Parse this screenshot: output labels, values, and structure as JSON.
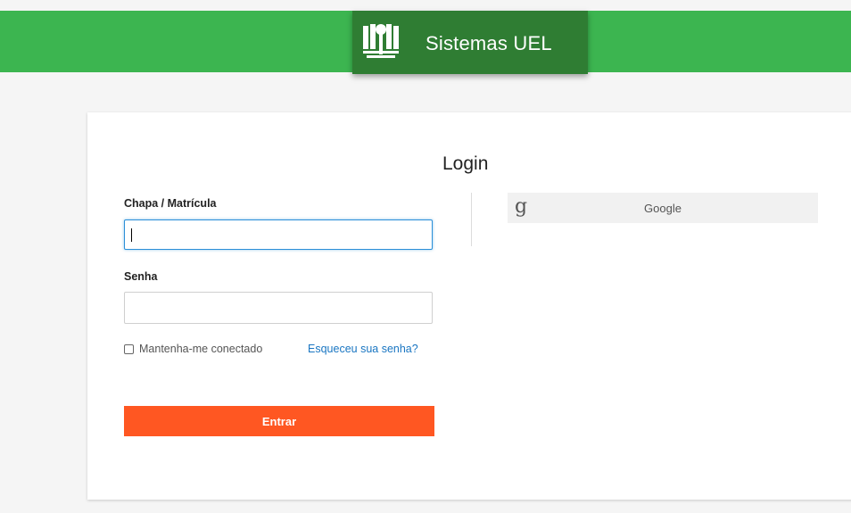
{
  "header": {
    "title": "Sistemas UEL",
    "logo_icon": "uel-logo-icon",
    "bar_color": "#3cb550",
    "brand_color": "#2f7d33"
  },
  "login": {
    "title": "Login",
    "user_label": "Chapa / Matrícula",
    "user_value": "",
    "password_label": "Senha",
    "password_value": "",
    "remember_label": "Mantenha-me conectado",
    "forgot_label": "Esqueceu sua senha?",
    "submit_label": "Entrar",
    "submit_color": "#ff5722"
  },
  "social": {
    "google_label": "Google",
    "google_icon": "google-g-icon"
  }
}
